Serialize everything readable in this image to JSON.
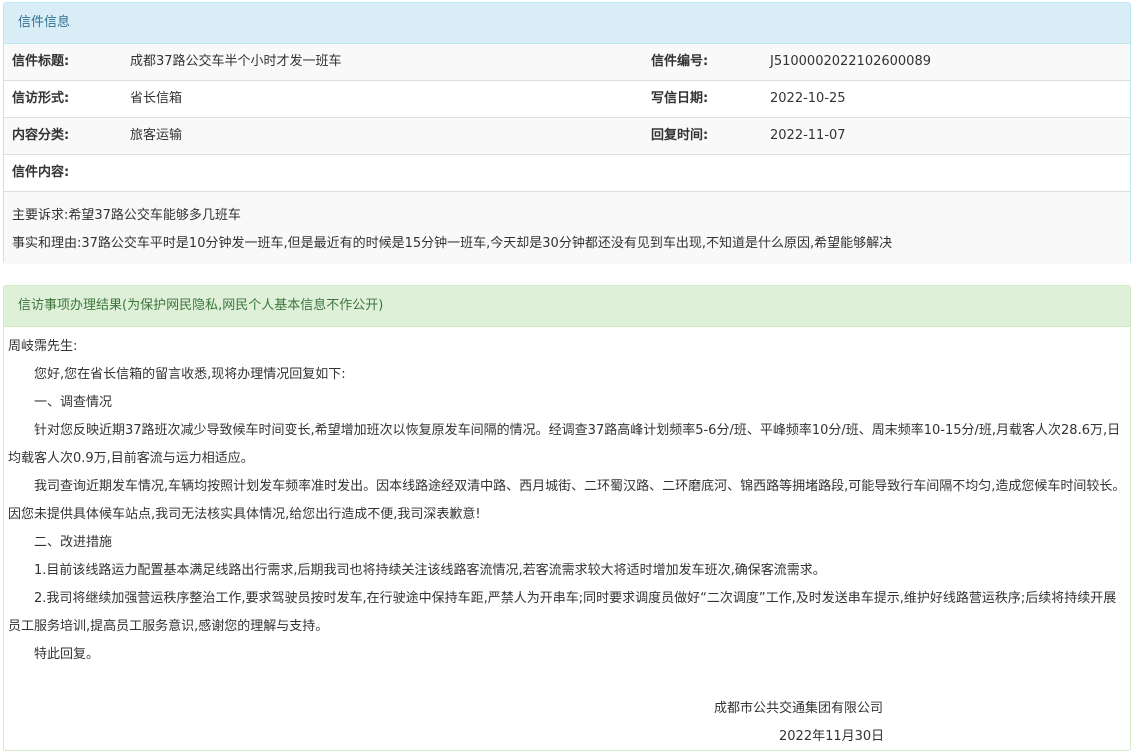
{
  "letter_info": {
    "heading": "信件信息",
    "title_label": "信件标题:",
    "title_value": "成都37路公交车半个小时才发一班车",
    "number_label": "信件编号:",
    "number_value": "J5100002022102600089",
    "form_label": "信访形式:",
    "form_value": "省长信箱",
    "date_label": "写信日期:",
    "date_value": "2022-10-25",
    "category_label": "内容分类:",
    "category_value": "旅客运输",
    "reply_time_label": "回复时间:",
    "reply_time_value": "2022-11-07",
    "content_label": "信件内容:",
    "content_request": "主要诉求:希望37路公交车能够多几班车",
    "content_reason": "事实和理由:37路公交车平时是10分钟发一班车,但是最近有的时候是15分钟一班车,今天却是30分钟都还没有见到车出现,不知道是什么原因,希望能够解决"
  },
  "result": {
    "heading": "信访事项办理结果(为保护网民隐私,网民个人基本信息不作公开)",
    "salutation": "周岐霈先生:",
    "paragraphs": [
      "您好,您在省长信箱的留言收悉,现将办理情况回复如下:",
      "一、调查情况",
      "针对您反映近期37路班次减少导致候车时间变长,希望增加班次以恢复原发车间隔的情况。经调查37路高峰计划频率5-6分/班、平峰频率10分/班、周末频率10-15分/班,月载客人次28.6万,日均载客人次0.9万,目前客流与运力相适应。",
      "我司查询近期发车情况,车辆均按照计划发车频率准时发出。因本线路途经双清中路、西月城街、二环蜀汉路、二环磨底河、锦西路等拥堵路段,可能导致行车间隔不均匀,造成您候车时间较长。因您未提供具体候车站点,我司无法核实具体情况,给您出行造成不便,我司深表歉意!",
      "二、改进措施",
      "1.目前该线路运力配置基本满足线路出行需求,后期我司也将持续关注该线路客流情况,若客流需求较大将适时增加发车班次,确保客流需求。",
      "2.我司将继续加强营运秩序整治工作,要求驾驶员按时发车,在行驶途中保持车距,严禁人为开串车;同时要求调度员做好“二次调度”工作,及时发送串车提示,维护好线路营运秩序;后续将持续开展员工服务培训,提高员工服务意识,感谢您的理解与支持。",
      "特此回复。"
    ],
    "signature_org": "成都市公共交通集团有限公司",
    "signature_date": "2022年11月30日"
  }
}
